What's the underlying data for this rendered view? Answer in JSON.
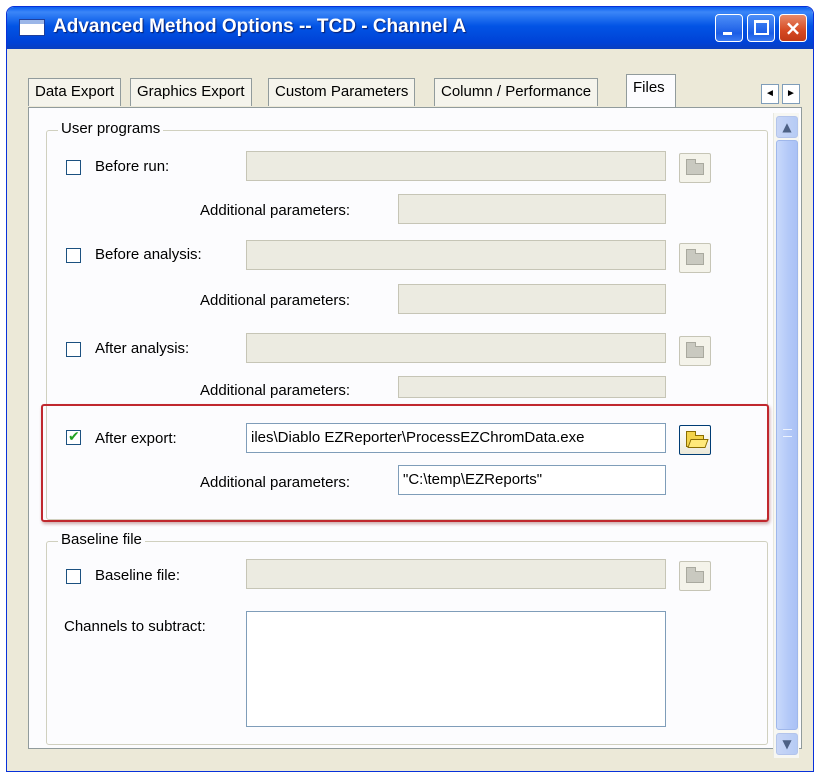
{
  "window": {
    "title": "Advanced Method Options -- TCD - Channel A",
    "close_glyph": "×"
  },
  "tabs": [
    {
      "label": "Data Export",
      "active": false
    },
    {
      "label": "Graphics Export",
      "active": false
    },
    {
      "label": "Custom Parameters",
      "active": false
    },
    {
      "label": "Column / Performance",
      "active": false
    },
    {
      "label": "Files",
      "active": true
    }
  ],
  "tab_scroll": {
    "left": "◄",
    "right": "►"
  },
  "user_programs": {
    "group_label": "User programs",
    "items": [
      {
        "label": "Before run:",
        "checked": false,
        "path": "",
        "params_label": "Additional parameters:",
        "params": ""
      },
      {
        "label": "Before analysis:",
        "checked": false,
        "path": "",
        "params_label": "Additional parameters:",
        "params": ""
      },
      {
        "label": "After analysis:",
        "checked": false,
        "path": "",
        "params_label": "Additional parameters:",
        "params": ""
      },
      {
        "label": "After export:",
        "checked": true,
        "path": "iles\\Diablo EZReporter\\ProcessEZChromData.exe",
        "params_label": "Additional parameters:",
        "params": "\"C:\\temp\\EZReports\""
      }
    ]
  },
  "baseline": {
    "group_label": "Baseline file",
    "checkbox_label": "Baseline file:",
    "checked": false,
    "path": "",
    "channels_label": "Channels to subtract:"
  },
  "scrollbar": {
    "up": "▲",
    "down": "▼"
  },
  "checkmark": "✔",
  "colors": {
    "titlebar": "#0254e5",
    "dialog_bg": "#ece9d8",
    "highlight_border": "#c0282e"
  }
}
